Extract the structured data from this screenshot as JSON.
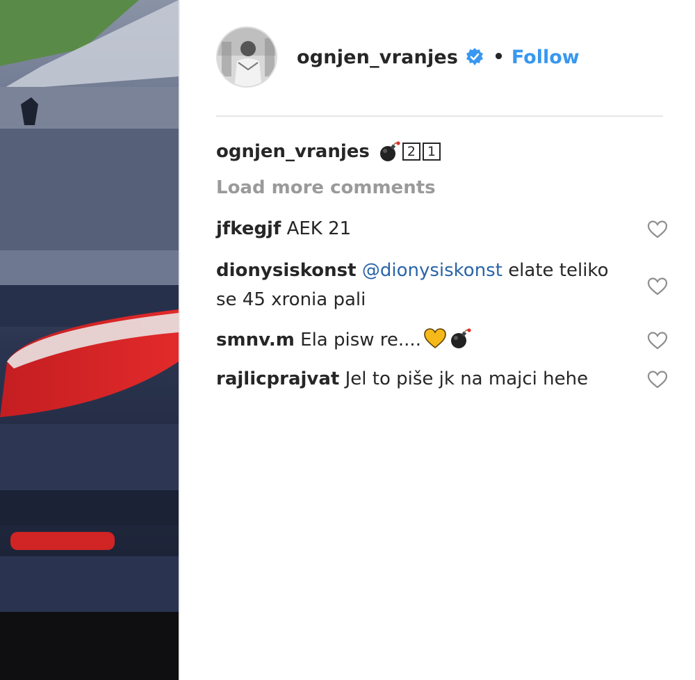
{
  "post": {
    "username": "ognjen_vranjes",
    "follow_label": "Follow",
    "separator": "•"
  },
  "caption": {
    "author": "ognjen_vranjes",
    "emoji": "bomb-icon",
    "box_digits": [
      "2",
      "1"
    ]
  },
  "load_more_label": "Load more comments",
  "comments": [
    {
      "user": "jfkegjf",
      "text": "AEK 21"
    },
    {
      "user": "dionysiskonst",
      "mention": "@dionysiskonst",
      "text": "elate teliko se 45 xronia pali"
    },
    {
      "user": "smnv.m",
      "text": "Ela pisw re....",
      "emojis": [
        "yellow-heart-icon",
        "bomb-icon"
      ]
    },
    {
      "user": "rajlicprajvat",
      "text": "Jel to piše jk na majci hehe"
    }
  ],
  "colors": {
    "link_blue": "#3897f0",
    "mention_blue": "#2a64a8",
    "text": "#262626",
    "muted": "#9a9a9a"
  }
}
